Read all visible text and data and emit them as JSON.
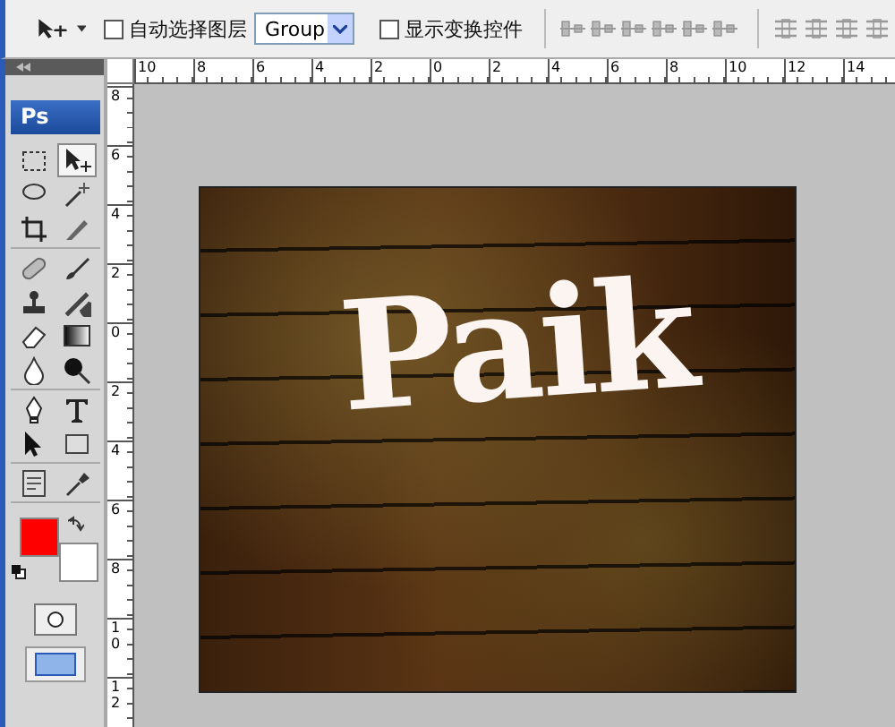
{
  "options_bar": {
    "auto_select": {
      "label": "自动选择图层",
      "checked": false
    },
    "dropdown": {
      "value": "Group"
    },
    "show_transform": {
      "label": "显示变换控件",
      "checked": false
    }
  },
  "toolbox": {
    "logo": "Ps",
    "tools": [
      {
        "selected": false
      },
      {
        "selected": true
      },
      {
        "selected": false
      },
      {
        "selected": false
      },
      {
        "selected": false
      },
      {
        "selected": false
      },
      {
        "selected": false
      },
      {
        "selected": false
      },
      {
        "selected": false
      },
      {
        "selected": false
      },
      {
        "selected": false
      },
      {
        "selected": false
      },
      {
        "selected": false
      },
      {
        "selected": false
      },
      {
        "selected": false
      },
      {
        "selected": false
      },
      {
        "selected": false
      },
      {
        "selected": false
      },
      {
        "selected": false
      },
      {
        "selected": false
      }
    ],
    "swatches": [
      {
        "color": "#ff0000"
      },
      {
        "color": "#ffffff"
      }
    ]
  },
  "rulers": {
    "horizontal": [
      "10",
      "8",
      "6",
      "4",
      "2",
      "0",
      "2",
      "4",
      "6",
      "8",
      "10",
      "12",
      "14"
    ],
    "vertical": [
      "8",
      "6",
      "4",
      "2",
      "0",
      "2",
      "4",
      "6",
      "8",
      "10",
      "12"
    ]
  },
  "document": {
    "canvas_text": "Paik"
  }
}
